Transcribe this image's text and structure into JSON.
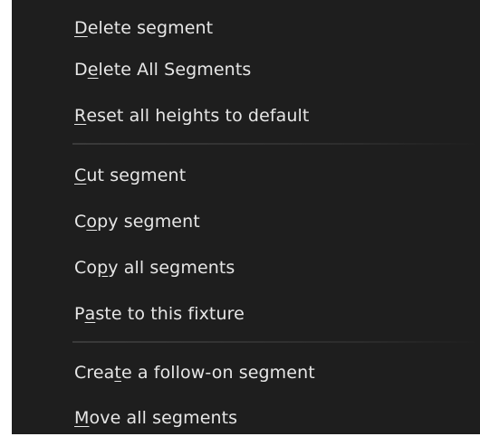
{
  "menu": {
    "groups": [
      {
        "items": [
          {
            "pre": "",
            "acc": "D",
            "post": "elete segment"
          },
          {
            "pre": "D",
            "acc": "e",
            "post": "lete All Segments"
          },
          {
            "pre": "",
            "acc": "R",
            "post": "eset all heights to default"
          }
        ]
      },
      {
        "items": [
          {
            "pre": "",
            "acc": "C",
            "post": "ut segment"
          },
          {
            "pre": "C",
            "acc": "o",
            "post": "py segment"
          },
          {
            "pre": "Co",
            "acc": "p",
            "post": "y all segments"
          },
          {
            "pre": "P",
            "acc": "a",
            "post": "ste to this fixture"
          }
        ]
      },
      {
        "items": [
          {
            "pre": "Crea",
            "acc": "t",
            "post": "e a follow-on segment"
          },
          {
            "pre": "",
            "acc": "M",
            "post": "ove all segments"
          }
        ]
      }
    ]
  }
}
